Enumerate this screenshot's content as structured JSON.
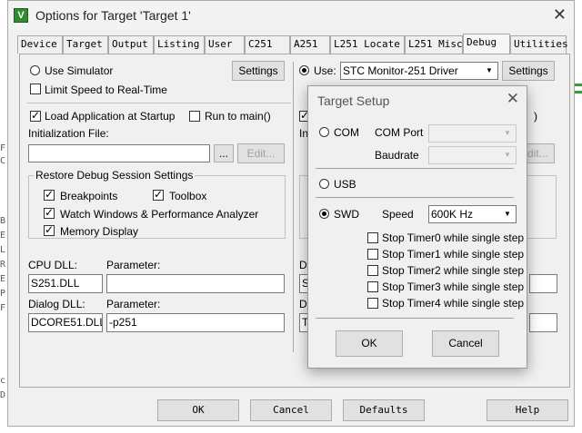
{
  "window": {
    "title": "Options for Target 'Target 1'",
    "icon_letter": "V",
    "close_glyph": "✕"
  },
  "tabs": [
    {
      "label": "Device"
    },
    {
      "label": "Target"
    },
    {
      "label": "Output"
    },
    {
      "label": "Listing"
    },
    {
      "label": "User"
    },
    {
      "label": "C251"
    },
    {
      "label": "A251"
    },
    {
      "label": "L251 Locate"
    },
    {
      "label": "L251 Misc"
    },
    {
      "label": "Debug"
    },
    {
      "label": "Utilities"
    }
  ],
  "left": {
    "use_simulator": "Use Simulator",
    "settings": "Settings",
    "limit_speed": "Limit Speed to Real-Time",
    "load_app": "Load Application at Startup",
    "run_to_main": "Run to main()",
    "init_file_label": "Initialization File:",
    "browse": "...",
    "edit": "Edit...",
    "restore_title": "Restore Debug Session Settings",
    "breakpoints": "Breakpoints",
    "toolbox": "Toolbox",
    "watch_windows": "Watch Windows & Performance Analyzer",
    "memory_display": "Memory Display",
    "cpu_dll_label": "CPU DLL:",
    "cpu_param_label": "Parameter:",
    "cpu_dll": "S251.DLL",
    "cpu_param": "",
    "dialog_dll_label": "Dialog DLL:",
    "dialog_param_label": "Parameter:",
    "dialog_dll": "DCORE51.DLL",
    "dialog_param": "-p251"
  },
  "right": {
    "use_label": "Use:",
    "driver": "STC Monitor-251 Driver",
    "settings": "Settings",
    "peek_ini": "Ini",
    "peek_paren": ")",
    "peek_edit": "dit...",
    "peek_dr": "Dr",
    "peek_s": "S",
    "peek_di": "Di",
    "peek_t": "T"
  },
  "bottom": {
    "ok": "OK",
    "cancel": "Cancel",
    "defaults": "Defaults",
    "help": "Help"
  },
  "target_setup": {
    "title": "Target Setup",
    "close_glyph": "✕",
    "com": "COM",
    "com_port_label": "COM Port",
    "baudrate_label": "Baudrate",
    "usb": "USB",
    "swd": "SWD",
    "speed_label": "Speed",
    "speed_value": "600K Hz",
    "stop_timers": [
      "Stop Timer0 while single step",
      "Stop Timer1 while single step",
      "Stop Timer2 while single step",
      "Stop Timer3 while single step",
      "Stop Timer4 while single step"
    ],
    "ok": "OK",
    "cancel": "Cancel"
  },
  "background_glyphs": [
    "F",
    "C",
    "B",
    "E",
    "L",
    "R",
    "E",
    "P",
    "F",
    "c",
    "D"
  ]
}
